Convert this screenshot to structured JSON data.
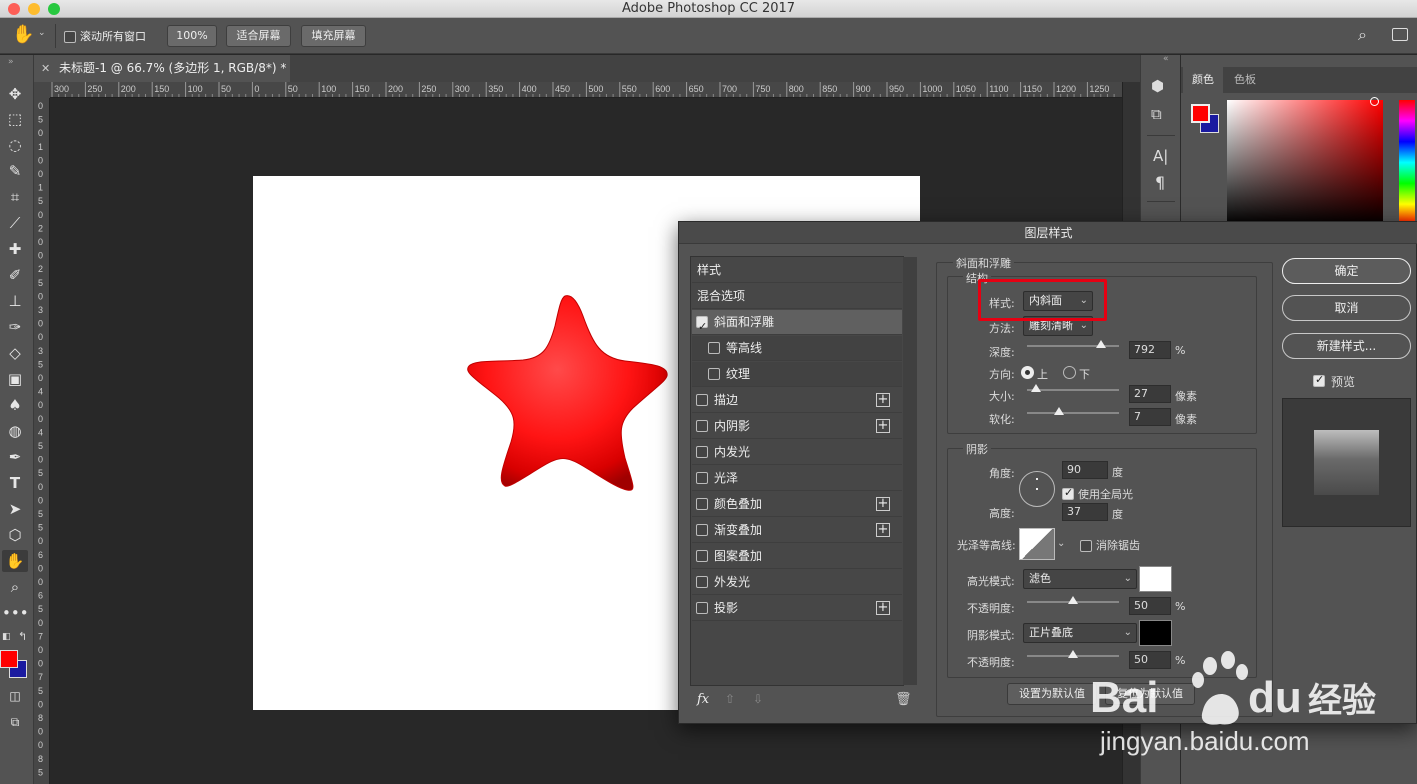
{
  "app": {
    "window_title": "Adobe Photoshop CC 2017"
  },
  "options_bar": {
    "scroll_all_label": "滚动所有窗口",
    "zoom_btn": "100%",
    "fit_btn": "适合屏幕",
    "fill_btn": "填充屏幕"
  },
  "document": {
    "tab_title": "未标题-1 @ 66.7% (多边形 1, RGB/8*) *"
  },
  "ruler": {
    "top_labels": [
      "300",
      "250",
      "200",
      "150",
      "100",
      "50",
      "0",
      "50",
      "100",
      "150",
      "200",
      "250",
      "300",
      "350",
      "400",
      "450",
      "500",
      "550",
      "600",
      "650",
      "700",
      "750",
      "800",
      "850",
      "900",
      "950",
      "1000",
      "1050",
      "1100",
      "1150",
      "1200",
      "1250"
    ],
    "left_labels": [
      "0",
      "5",
      "0",
      "1",
      "0",
      "0",
      "1",
      "5",
      "0",
      "2",
      "0",
      "0",
      "2",
      "5",
      "0",
      "3",
      "0",
      "0",
      "3",
      "5",
      "0",
      "4",
      "0",
      "0",
      "4",
      "5",
      "0",
      "5",
      "0",
      "0",
      "5",
      "5",
      "0",
      "6",
      "0",
      "0",
      "6",
      "5",
      "0",
      "7",
      "0",
      "0",
      "7",
      "5",
      "0",
      "8",
      "0",
      "0",
      "8",
      "5"
    ]
  },
  "panels": {
    "color_tab": "颜色",
    "swatches_tab": "色板"
  },
  "colors": {
    "foreground": "#ff0000",
    "background": "#1a1aa0",
    "star": "#ff1a1a",
    "highlight_color": "#ffffff",
    "shadow_color": "#000000"
  },
  "dialog": {
    "title": "图层样式",
    "style_list": [
      {
        "label": "样式",
        "checkbox": false,
        "plus": false
      },
      {
        "label": "混合选项",
        "checkbox": false,
        "plus": false
      },
      {
        "label": "斜面和浮雕",
        "checkbox": true,
        "checked": true,
        "plus": false
      },
      {
        "label": "等高线",
        "checkbox": true,
        "checked": false,
        "plus": false,
        "sub": true
      },
      {
        "label": "纹理",
        "checkbox": true,
        "checked": false,
        "plus": false,
        "sub": true
      },
      {
        "label": "描边",
        "checkbox": true,
        "checked": false,
        "plus": true
      },
      {
        "label": "内阴影",
        "checkbox": true,
        "checked": false,
        "plus": true
      },
      {
        "label": "内发光",
        "checkbox": true,
        "checked": false,
        "plus": false
      },
      {
        "label": "光泽",
        "checkbox": true,
        "checked": false,
        "plus": false
      },
      {
        "label": "颜色叠加",
        "checkbox": true,
        "checked": false,
        "plus": true
      },
      {
        "label": "渐变叠加",
        "checkbox": true,
        "checked": false,
        "plus": true
      },
      {
        "label": "图案叠加",
        "checkbox": true,
        "checked": false,
        "plus": false
      },
      {
        "label": "外发光",
        "checkbox": true,
        "checked": false,
        "plus": false
      },
      {
        "label": "投影",
        "checkbox": true,
        "checked": false,
        "plus": true
      }
    ],
    "fx_label": "fx",
    "bevel": {
      "section_title": "斜面和浮雕",
      "structure_title": "结构",
      "style_label": "样式:",
      "style_value": "内斜面",
      "technique_label": "方法:",
      "technique_value": "雕刻清晰",
      "depth_label": "深度:",
      "depth_value": "792",
      "depth_unit": "%",
      "depth_slider": 0.8,
      "direction_label": "方向:",
      "direction_up": "上",
      "direction_down": "下",
      "size_label": "大小:",
      "size_value": "27",
      "size_unit": "像素",
      "size_slider": 0.1,
      "soften_label": "软化:",
      "soften_value": "7",
      "soften_unit": "像素",
      "soften_slider": 0.35
    },
    "shading": {
      "section_title": "阴影",
      "angle_label": "角度:",
      "angle_value": "90",
      "angle_unit": "度",
      "global_light_label": "使用全局光",
      "altitude_label": "高度:",
      "altitude_value": "37",
      "altitude_unit": "度",
      "gloss_contour_label": "光泽等高线:",
      "antialias_label": "消除锯齿",
      "highlight_mode_label": "高光模式:",
      "highlight_mode_value": "滤色",
      "highlight_opacity_label": "不透明度:",
      "highlight_opacity_value": "50",
      "highlight_opacity_unit": "%",
      "highlight_opacity_slider": 0.5,
      "shadow_mode_label": "阴影模式:",
      "shadow_mode_value": "正片叠底",
      "shadow_opacity_label": "不透明度:",
      "shadow_opacity_value": "50",
      "shadow_opacity_unit": "%",
      "shadow_opacity_slider": 0.5
    },
    "make_default": "设置为默认值",
    "reset_default": "复位为默认值",
    "ok": "确定",
    "cancel": "取消",
    "new_style": "新建样式...",
    "preview_label": "预览"
  },
  "watermark": {
    "brand": "Bai",
    "brand2": "du",
    "product": "经验",
    "url": "jingyan.baidu.com"
  }
}
